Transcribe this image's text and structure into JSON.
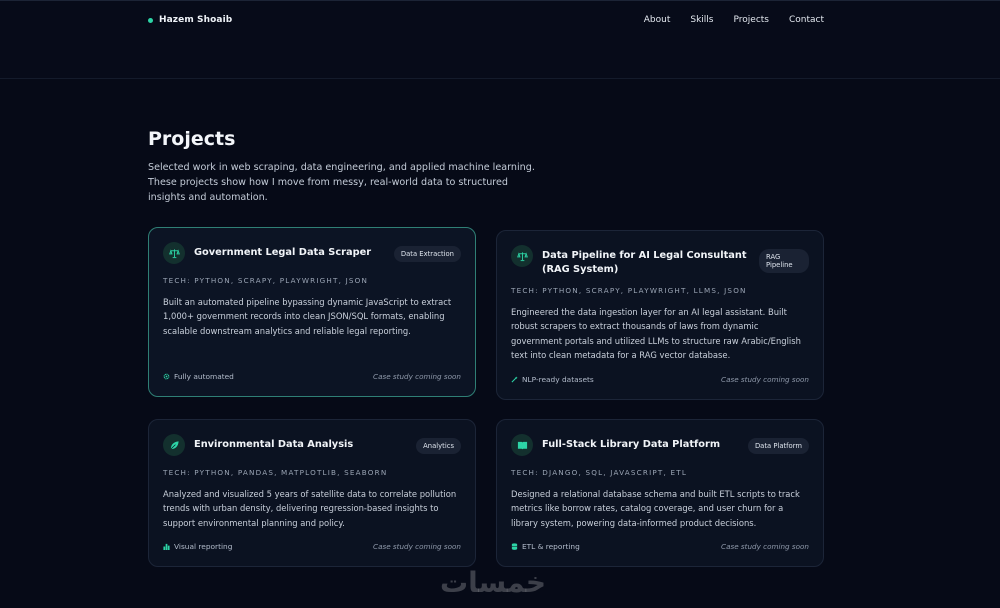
{
  "header": {
    "brand": "Hazem Shoaib",
    "nav": [
      "About",
      "Skills",
      "Projects",
      "Contact"
    ]
  },
  "section": {
    "title": "Projects",
    "intro": "Selected work in web scraping, data engineering, and applied machine learning. These projects show how I move from messy, real-world data to structured insights and automation."
  },
  "projects": [
    {
      "title": "Government Legal Data Scraper",
      "badge": "Data Extraction",
      "icon": "scale-icon",
      "tech": "TECH: PYTHON, SCRAPY, PLAYWRIGHT, JSON",
      "description": "Built an automated pipeline bypassing dynamic JavaScript to extract 1,000+ government records into clean JSON/SQL formats, enabling scalable downstream analytics and reliable legal reporting.",
      "footer_icon": "gear-icon",
      "footer": "Fully automated",
      "status": "Case study coming soon"
    },
    {
      "title": "Data Pipeline for AI Legal Consultant (RAG System)",
      "badge": "RAG Pipeline",
      "icon": "scale-icon",
      "tech": "TECH: PYTHON, SCRAPY, PLAYWRIGHT, LLMS, JSON",
      "description": "Engineered the data ingestion layer for an AI legal assistant. Built robust scrapers to extract thousands of laws from dynamic government portals and utilized LLMs to structure raw Arabic/English text into clean metadata for a RAG vector database.",
      "footer_icon": "wand-icon",
      "footer": "NLP-ready datasets",
      "status": "Case study coming soon"
    },
    {
      "title": "Environmental Data Analysis",
      "badge": "Analytics",
      "icon": "leaf-icon",
      "tech": "TECH: PYTHON, PANDAS, MATPLOTLIB, SEABORN",
      "description": "Analyzed and visualized 5 years of satellite data to correlate pollution trends with urban density, delivering regression-based insights to support environmental planning and policy.",
      "footer_icon": "bar-chart-icon",
      "footer": "Visual reporting",
      "status": "Case study coming soon"
    },
    {
      "title": "Full-Stack Library Data Platform",
      "badge": "Data Platform",
      "icon": "book-icon",
      "tech": "TECH: DJANGO, SQL, JAVASCRIPT, ETL",
      "description": "Designed a relational database schema and built ETL scripts to track metrics like borrow rates, catalog coverage, and user churn for a library system, powering data-informed product decisions.",
      "footer_icon": "database-icon",
      "footer": "ETL & reporting",
      "status": "Case study coming soon"
    }
  ],
  "colors": {
    "background": "#060a17",
    "card": "#0b1221",
    "accent": "#2dd4a6",
    "active_border": "#2f7f75"
  }
}
